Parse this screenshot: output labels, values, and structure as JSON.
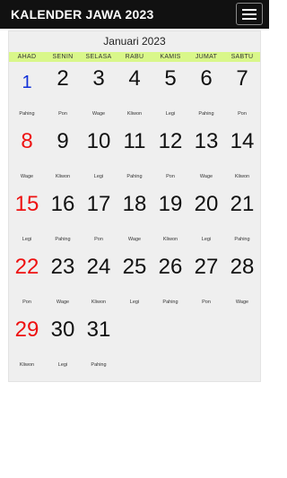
{
  "app": {
    "title": "KALENDER JAWA 2023"
  },
  "calendar": {
    "month": "Januari 2023",
    "days": [
      "AHAD",
      "SENIN",
      "SELASA",
      "RABU",
      "KAMIS",
      "JUMAT",
      "SABTU"
    ],
    "weeks": [
      [
        {
          "d": "1",
          "p": "Pahing",
          "type": "holiday"
        },
        {
          "d": "2",
          "p": "Pon"
        },
        {
          "d": "3",
          "p": "Wage"
        },
        {
          "d": "4",
          "p": "Kliwon"
        },
        {
          "d": "5",
          "p": "Legi"
        },
        {
          "d": "6",
          "p": "Pahing"
        },
        {
          "d": "7",
          "p": "Pon"
        }
      ],
      [
        {
          "d": "8",
          "p": "Wage",
          "type": "sunday"
        },
        {
          "d": "9",
          "p": "Kliwon"
        },
        {
          "d": "10",
          "p": "Legi"
        },
        {
          "d": "11",
          "p": "Pahing"
        },
        {
          "d": "12",
          "p": "Pon"
        },
        {
          "d": "13",
          "p": "Wage"
        },
        {
          "d": "14",
          "p": "Kliwon"
        }
      ],
      [
        {
          "d": "15",
          "p": "Legi",
          "type": "sunday"
        },
        {
          "d": "16",
          "p": "Pahing"
        },
        {
          "d": "17",
          "p": "Pon"
        },
        {
          "d": "18",
          "p": "Wage"
        },
        {
          "d": "19",
          "p": "Kliwon"
        },
        {
          "d": "20",
          "p": "Legi"
        },
        {
          "d": "21",
          "p": "Pahing"
        }
      ],
      [
        {
          "d": "22",
          "p": "Pon",
          "type": "sunday"
        },
        {
          "d": "23",
          "p": "Wage"
        },
        {
          "d": "24",
          "p": "Kliwon"
        },
        {
          "d": "25",
          "p": "Legi"
        },
        {
          "d": "26",
          "p": "Pahing"
        },
        {
          "d": "27",
          "p": "Pon"
        },
        {
          "d": "28",
          "p": "Wage"
        }
      ],
      [
        {
          "d": "29",
          "p": "Kliwon",
          "type": "sunday"
        },
        {
          "d": "30",
          "p": "Legi"
        },
        {
          "d": "31",
          "p": "Pahing"
        }
      ]
    ]
  },
  "colors": {
    "appbar": "#111111",
    "dayhead_bg": "#d9f78a",
    "sunday": "#ee1111",
    "holiday": "#1030d8"
  }
}
